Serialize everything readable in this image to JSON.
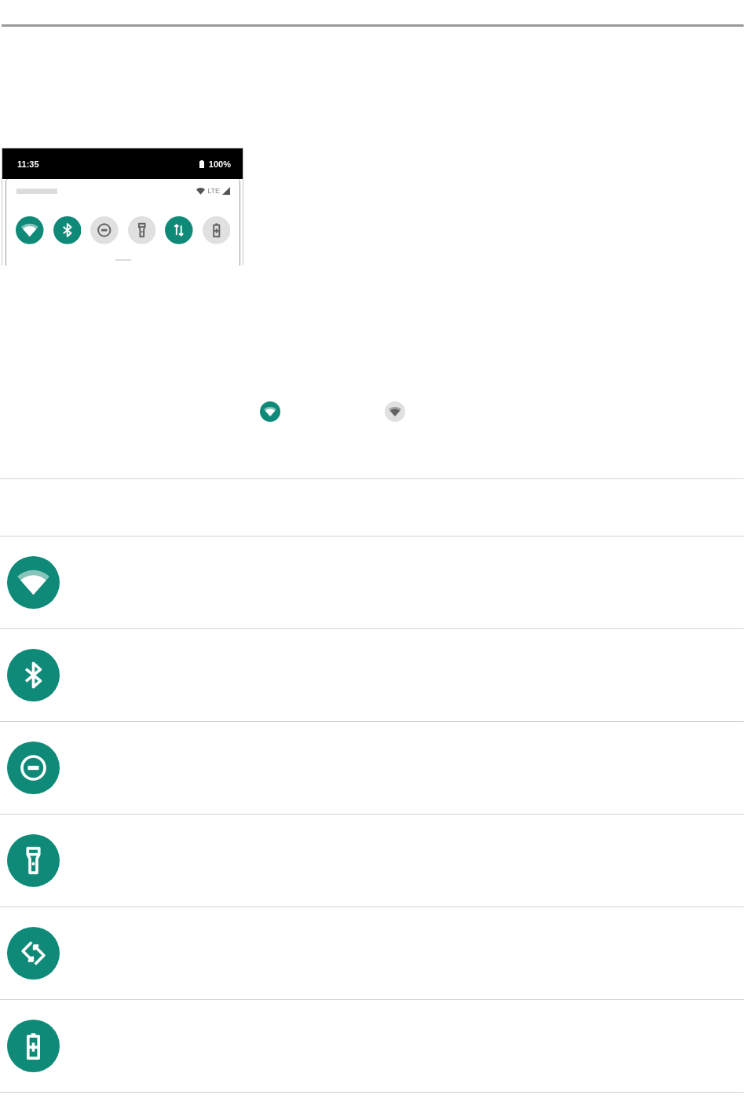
{
  "phone_screenshot": {
    "status_bar": {
      "time": "11:35",
      "battery": "100%"
    },
    "quick_settings": {
      "network": "LTE",
      "tiles": [
        {
          "kind": "wifi",
          "on": true
        },
        {
          "kind": "bluetooth",
          "on": true
        },
        {
          "kind": "do_not_disturb",
          "on": false
        },
        {
          "kind": "flashlight",
          "on": false
        },
        {
          "kind": "mobile_data",
          "on": true
        },
        {
          "kind": "battery_saver",
          "on": false
        }
      ]
    }
  },
  "legend": [
    {
      "kind": "wifi",
      "on": true
    },
    {
      "kind": "wifi",
      "on": false
    }
  ],
  "feature_table": {
    "rows": [
      {
        "kind": "wifi"
      },
      {
        "kind": "bluetooth"
      },
      {
        "kind": "do_not_disturb"
      },
      {
        "kind": "flashlight"
      },
      {
        "kind": "auto_rotate"
      },
      {
        "kind": "battery_saver"
      }
    ]
  }
}
